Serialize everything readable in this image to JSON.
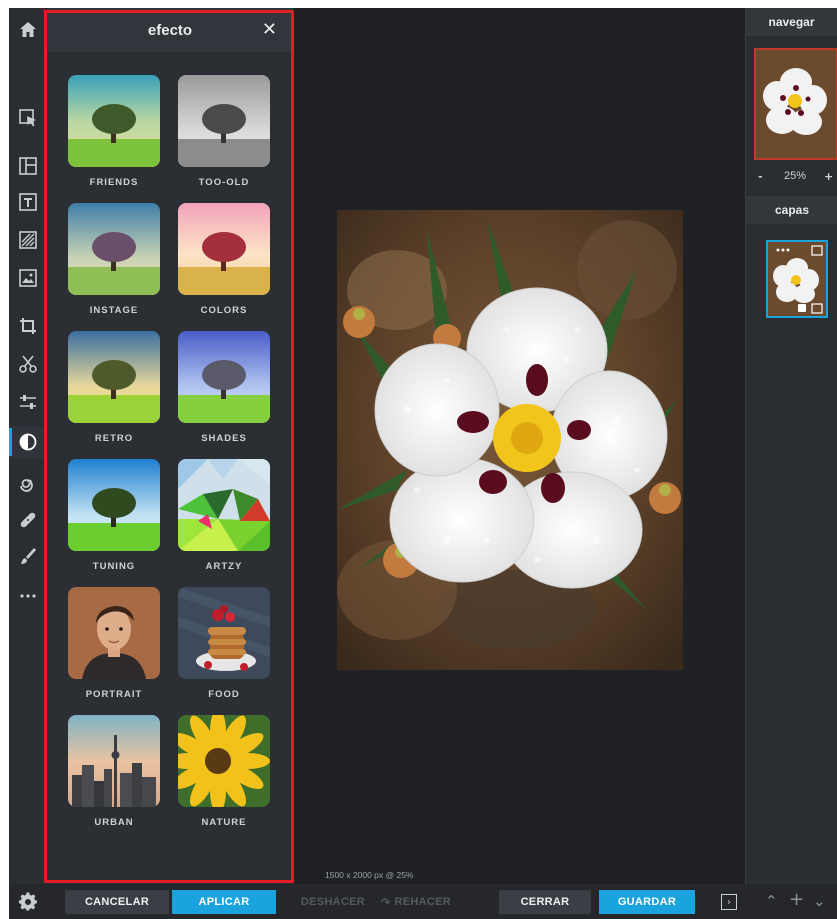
{
  "panel": {
    "title": "efecto",
    "close_symbol": "✕",
    "effects": [
      {
        "label": "FRIENDS"
      },
      {
        "label": "TOO-OLD"
      },
      {
        "label": "INSTAGE"
      },
      {
        "label": "COLORS"
      },
      {
        "label": "RETRO"
      },
      {
        "label": "SHADES"
      },
      {
        "label": "TUNING"
      },
      {
        "label": "ARTZY"
      },
      {
        "label": "PORTRAIT"
      },
      {
        "label": "FOOD"
      },
      {
        "label": "URBAN"
      },
      {
        "label": "NATURE"
      }
    ]
  },
  "toolbar": {
    "active_tool": "adjust-effect-icon",
    "tools": [
      "home-icon",
      "select-icon",
      "layout-icon",
      "text-icon",
      "texture-icon",
      "image-icon",
      "crop-icon",
      "cut-icon",
      "adjust-icon",
      "effect-icon",
      "swirl-icon",
      "heal-icon",
      "brush-icon",
      "more-icon"
    ]
  },
  "right": {
    "navigator_title": "navegar",
    "zoom_minus": "-",
    "zoom_value": "25%",
    "zoom_plus": "+",
    "layers_title": "capas"
  },
  "canvas": {
    "size_info": "1500 x 2000 px @ 25%"
  },
  "bottom": {
    "cancel": "CANCELAR",
    "apply": "APLICAR",
    "undo": "DESHACER",
    "redo": "REHACER",
    "close": "CERRAR",
    "save": "GUARDAR"
  },
  "colors": {
    "accent": "#1aa3dc",
    "highlight_frame": "#e51c23"
  }
}
